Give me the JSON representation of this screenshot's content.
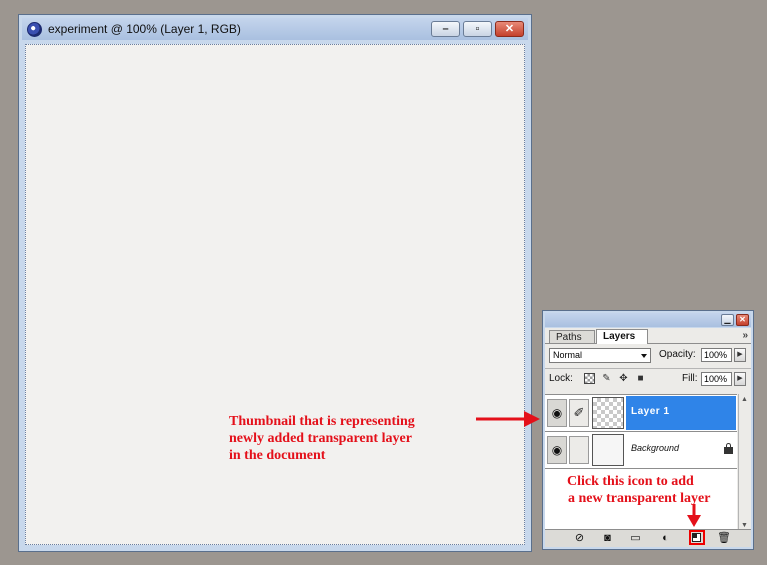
{
  "document_window": {
    "title": "experiment @ 100% (Layer 1, RGB)",
    "buttons": {
      "minimize": "–",
      "maximize": "▫",
      "close": "✕"
    }
  },
  "layers_panel": {
    "tabs": [
      {
        "label": "Paths",
        "active": false
      },
      {
        "label": "Layers",
        "active": true
      }
    ],
    "flyout_symbol": "»",
    "blend_mode": "Normal",
    "opacity_label": "Opacity:",
    "opacity_value": "100%",
    "lock_label": "Lock:",
    "fill_label": "Fill:",
    "fill_value": "100%",
    "layers": [
      {
        "name": "Layer 1",
        "selected": true,
        "visible": true,
        "thumbnail": "transparent-checkerboard"
      },
      {
        "name": "Background",
        "selected": false,
        "visible": true,
        "thumbnail": "white",
        "locked": true
      }
    ],
    "bottom_icons": [
      "layer-style-icon",
      "layer-mask-icon",
      "layer-set-folder-icon",
      "adjustment-layer-icon",
      "new-layer-icon",
      "trash-icon"
    ]
  },
  "annotations": {
    "thumbnail_note": [
      "Thumbnail that is representing",
      "newly added transparent layer",
      "in the document"
    ],
    "click_note": [
      "Click this icon to add",
      "a new transparent layer"
    ]
  },
  "colors": {
    "desktop": "#9c9690",
    "annotation_red": "#e4101a",
    "selected_layer": "#2f84e8",
    "canvas": "#f2f1ef"
  }
}
